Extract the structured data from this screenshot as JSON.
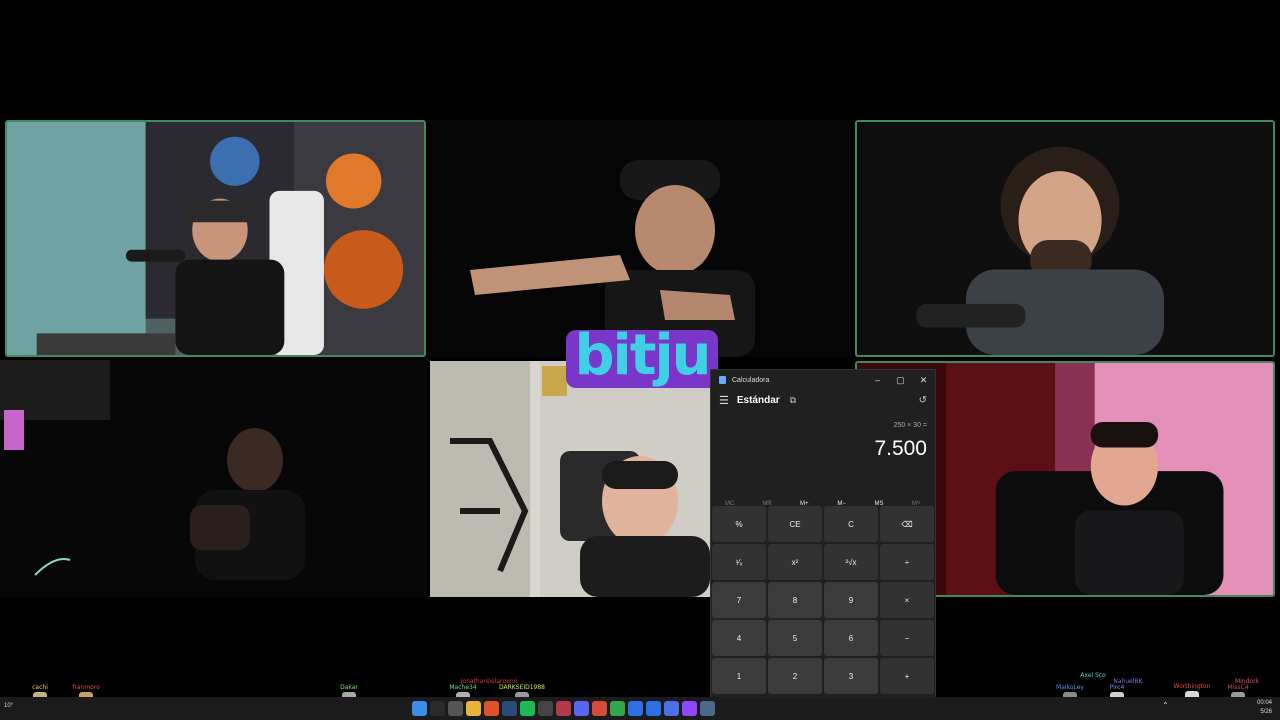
{
  "logo": {
    "text": "bitju"
  },
  "calculator": {
    "window_title": "Calculadora",
    "window_buttons": [
      "–",
      "▢",
      "✕"
    ],
    "menu_icon": "hamburger-icon",
    "mode": "Estándar",
    "keep_on_top_icon": "keep-on-top-icon",
    "history_icon": "history-icon",
    "expression": "250 × 30 =",
    "result": "7.500",
    "memory": [
      {
        "label": "MC",
        "enabled": false
      },
      {
        "label": "MR",
        "enabled": false
      },
      {
        "label": "M+",
        "enabled": true
      },
      {
        "label": "M−",
        "enabled": true
      },
      {
        "label": "MS",
        "enabled": true
      },
      {
        "label": "M˅",
        "enabled": false
      }
    ],
    "keys": [
      {
        "label": "%",
        "type": "fn",
        "name": "percent-key"
      },
      {
        "label": "CE",
        "type": "fn",
        "name": "clear-entry-key"
      },
      {
        "label": "C",
        "type": "fn",
        "name": "clear-key"
      },
      {
        "label": "⌫",
        "type": "fn",
        "name": "backspace-key"
      },
      {
        "label": "¹⁄ₓ",
        "type": "fn",
        "name": "reciprocal-key"
      },
      {
        "label": "x²",
        "type": "fn",
        "name": "square-key"
      },
      {
        "label": "²√x",
        "type": "fn",
        "name": "sqrt-key"
      },
      {
        "label": "÷",
        "type": "fn",
        "name": "divide-key"
      },
      {
        "label": "7",
        "type": "num",
        "name": "digit-7-key"
      },
      {
        "label": "8",
        "type": "num",
        "name": "digit-8-key"
      },
      {
        "label": "9",
        "type": "num",
        "name": "digit-9-key"
      },
      {
        "label": "×",
        "type": "fn",
        "name": "multiply-key"
      },
      {
        "label": "4",
        "type": "num",
        "name": "digit-4-key"
      },
      {
        "label": "5",
        "type": "num",
        "name": "digit-5-key"
      },
      {
        "label": "6",
        "type": "num",
        "name": "digit-6-key"
      },
      {
        "label": "−",
        "type": "fn",
        "name": "minus-key"
      },
      {
        "label": "1",
        "type": "num",
        "name": "digit-1-key"
      },
      {
        "label": "2",
        "type": "num",
        "name": "digit-2-key"
      },
      {
        "label": "3",
        "type": "num",
        "name": "digit-3-key"
      },
      {
        "label": "+",
        "type": "fn",
        "name": "plus-key"
      }
    ]
  },
  "taskbar": {
    "weather": "10°",
    "tray_time": "00:04",
    "tray_date": "5/26",
    "pinned_icons": [
      {
        "name": "windows-start-icon",
        "color": "#3a8ee6"
      },
      {
        "name": "search-icon",
        "color": "#2a2a2a"
      },
      {
        "name": "task-view-icon",
        "color": "#555555"
      },
      {
        "name": "file-explorer-icon",
        "color": "#e8b33a"
      },
      {
        "name": "brave-browser-icon",
        "color": "#e0512b"
      },
      {
        "name": "steam-icon",
        "color": "#2a4a7a"
      },
      {
        "name": "spotify-icon",
        "color": "#1db954"
      },
      {
        "name": "obs-icon",
        "color": "#444444"
      },
      {
        "name": "terminal-icon",
        "color": "#b23a48"
      },
      {
        "name": "discord-icon",
        "color": "#5865f2"
      },
      {
        "name": "chrome-icon",
        "color": "#d44b3a"
      },
      {
        "name": "media-player-icon",
        "color": "#2ea84a"
      },
      {
        "name": "bitju-app-icon",
        "color": "#2f6fe6"
      },
      {
        "name": "bitju-alt-icon",
        "color": "#2f6fe6"
      },
      {
        "name": "diamond-app-icon",
        "color": "#4a6fe6"
      },
      {
        "name": "twitch-icon",
        "color": "#9146ff"
      },
      {
        "name": "calculator-icon",
        "color": "#4a6a8a"
      }
    ]
  },
  "viewers": [
    {
      "name": "cachi",
      "color": "#e8d04a"
    },
    {
      "name": "franmoro",
      "color": "#e84a4a"
    },
    {
      "name": "Dakar",
      "color": "#7ce06a"
    },
    {
      "name": "Jonathanbelarmino",
      "color": "#d23a3a"
    },
    {
      "name": "Mache34",
      "color": "#6ae08a"
    },
    {
      "name": "DARKSEID1988",
      "color": "#c8e84a"
    },
    {
      "name": "Axel Sco",
      "color": "#4ae0c8"
    },
    {
      "name": "MaikoLey",
      "color": "#4a9ae8"
    },
    {
      "name": "NahuelBK",
      "color": "#8a6ae8"
    },
    {
      "name": "Pirc4",
      "color": "#6a9ae8"
    },
    {
      "name": "Worthington",
      "color": "#e84a4a"
    },
    {
      "name": "Mindork",
      "color": "#e84a6a"
    },
    {
      "name": "MissC4",
      "color": "#d04a4a"
    }
  ]
}
